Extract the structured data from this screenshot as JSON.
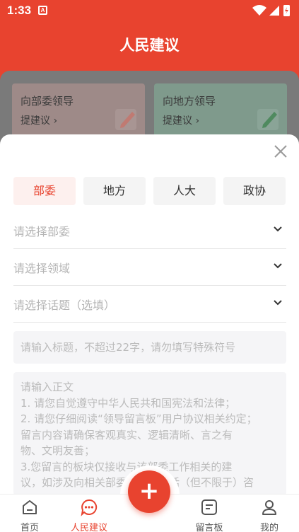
{
  "status_bar": {
    "time": "1:33",
    "notification_letter": "A"
  },
  "header": {
    "title": "人民建议"
  },
  "background_cards": [
    {
      "title": "向部委领导",
      "action": "提建议 ›"
    },
    {
      "title": "向地方领导",
      "action": "提建议 ›"
    }
  ],
  "form": {
    "tabs": [
      {
        "label": "部委",
        "active": true
      },
      {
        "label": "地方",
        "active": false
      },
      {
        "label": "人大",
        "active": false
      },
      {
        "label": "政协",
        "active": false
      }
    ],
    "selects": [
      {
        "placeholder": "请选择部委"
      },
      {
        "placeholder": "请选择领域"
      },
      {
        "placeholder": "请选择话题（选填）"
      }
    ],
    "title_placeholder": "请输入标题，不超过22字，请勿填写特殊符号",
    "body_placeholder_lines": [
      "请输入正文",
      "1. 请您自觉遵守中华人民共和国宪法和法律；",
      "2. 请您仔细阅读“领导留言板”用户协议相关约定；",
      "留言内容请确保客观真实、逻辑清晰、言之有",
      "物、文明友善；",
      "3.您留言的板块仅接收与该部委工作相关的建",
      "议，如涉及向相关部委建议，包括（但不限于）咨"
    ]
  },
  "bottom_nav": {
    "items": [
      {
        "label": "首页",
        "icon": "home-icon",
        "active": false
      },
      {
        "label": "人民建议",
        "icon": "chat-bubble-icon",
        "active": true
      },
      {
        "label": "留言板",
        "icon": "message-board-icon",
        "active": false
      },
      {
        "label": "我的",
        "icon": "person-icon",
        "active": false
      }
    ],
    "fab_symbol": "+"
  },
  "colors": {
    "accent": "#e8432f",
    "tab_active_bg": "#fdf0ee",
    "input_bg": "#f5f5f7"
  }
}
